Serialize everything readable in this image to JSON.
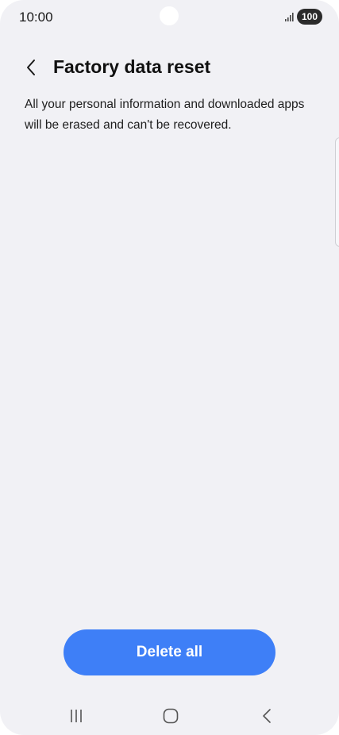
{
  "status_bar": {
    "time": "10:00",
    "battery": "100",
    "signal_icon": "signal-bars-icon"
  },
  "header": {
    "back_icon": "chevron-left-icon",
    "title": "Factory data reset"
  },
  "main": {
    "description": "All your personal information and downloaded apps will be erased and can't be recovered."
  },
  "actions": {
    "delete_label": "Delete all"
  },
  "nav_bar": {
    "recents_icon": "recents-icon",
    "home_icon": "home-icon",
    "back_icon": "back-icon"
  },
  "colors": {
    "background": "#f1f1f5",
    "accent": "#3e7ff7",
    "battery_badge": "#2b2b2b"
  }
}
